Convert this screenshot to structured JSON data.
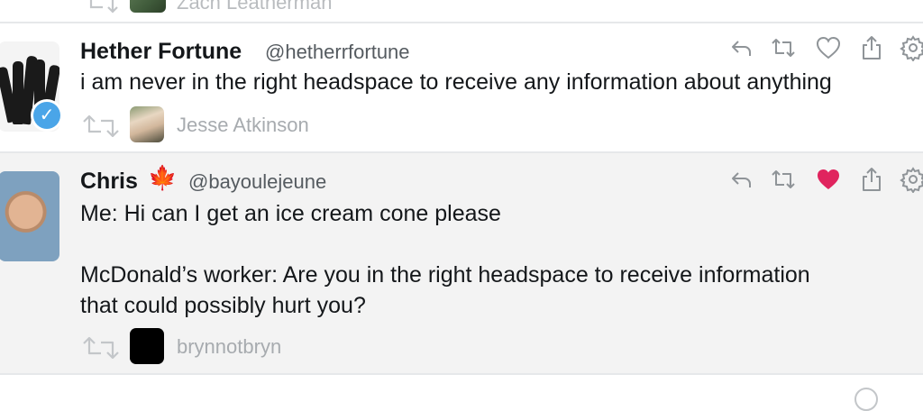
{
  "timeline": {
    "previous": {
      "retweeter_name": "Zach Leatherman"
    },
    "tweets": [
      {
        "display_name": "Hether Fortune",
        "handle": "@hetherrfortune",
        "text_lines": [
          "i am never in the right headspace to receive any information about anything"
        ],
        "retweeted_by": "Jesse Atkinson",
        "liked": false,
        "verified": true
      },
      {
        "display_name": "Chris",
        "name_emoji": "🍁",
        "handle": "@bayoulejeune",
        "text_lines": [
          "Me: Hi can I get an ice cream cone please",
          "",
          "McDonald’s worker: Are you in the right headspace to receive information",
          "that could possibly hurt you?"
        ],
        "retweeted_by": "brynnotbryn",
        "liked": true,
        "verified": false
      }
    ]
  },
  "colors": {
    "like_active": "#e0245e",
    "icon_gray": "#8f9498",
    "verified_blue": "#4aa5e8",
    "selected_row_bg": "#f3f3f3"
  },
  "icons": [
    "reply-icon",
    "retweet-icon",
    "like-icon",
    "share-icon",
    "gear-icon"
  ]
}
